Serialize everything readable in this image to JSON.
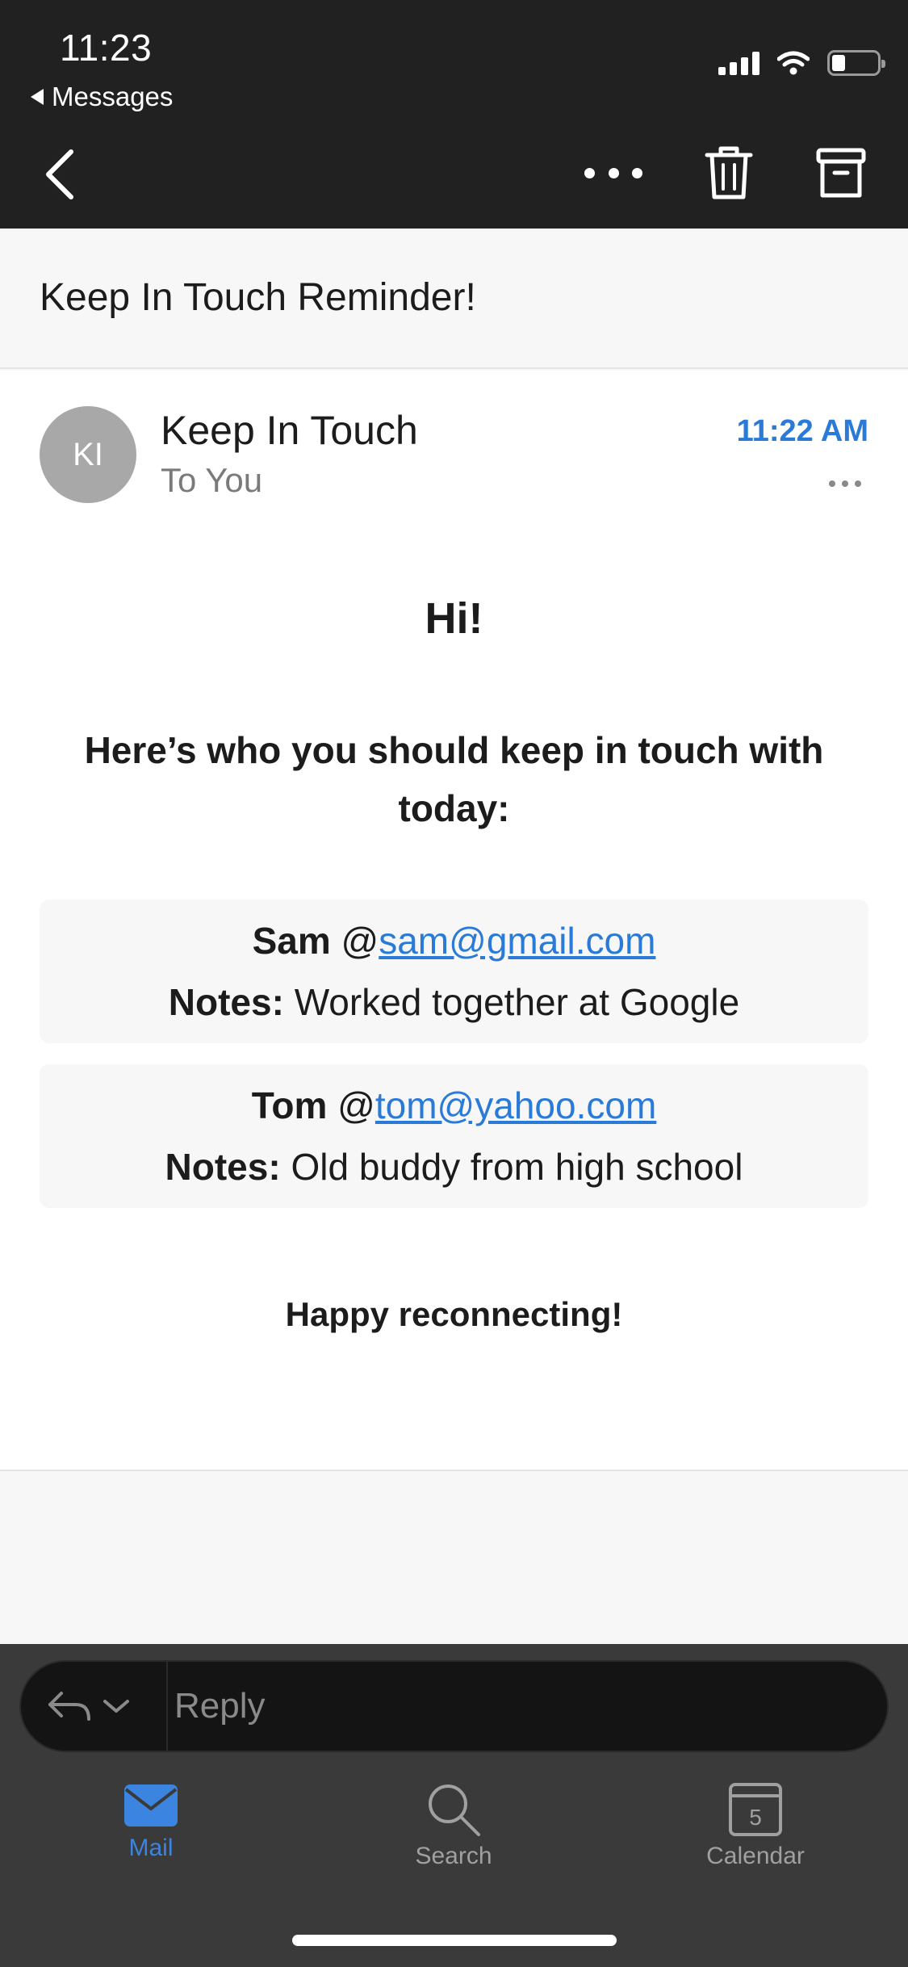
{
  "status_bar": {
    "time": "11:23",
    "back_app": "Messages"
  },
  "toolbar": {
    "icons": [
      "chevron-left-icon",
      "more-horizontal-icon",
      "trash-icon",
      "archive-icon"
    ]
  },
  "subject": "Keep In Touch Reminder!",
  "message": {
    "avatar_initials": "KI",
    "sender": "Keep In Touch",
    "recipient": "To You",
    "time": "11:22 AM",
    "greeting": "Hi!",
    "intro": "Here’s who you should keep in touch with today:",
    "contacts": [
      {
        "name": "Sam",
        "at": "@",
        "email": "sam@gmail.com",
        "notes_label": "Notes:",
        "notes": "Worked together at Google"
      },
      {
        "name": "Tom",
        "at": "@",
        "email": "tom@yahoo.com",
        "notes_label": "Notes:",
        "notes": "Old buddy from high school"
      }
    ],
    "closing": "Happy reconnecting!"
  },
  "reply": {
    "placeholder": "Reply"
  },
  "tabs": [
    {
      "label": "Mail",
      "icon": "mail-icon",
      "active": true
    },
    {
      "label": "Search",
      "icon": "search-icon",
      "active": false
    },
    {
      "label": "Calendar",
      "icon": "calendar-icon",
      "active": false,
      "badge": "5"
    }
  ],
  "colors": {
    "accent": "#2a7ad8",
    "header_bg": "#212121",
    "tab_bar_bg": "#3a3a3a"
  }
}
